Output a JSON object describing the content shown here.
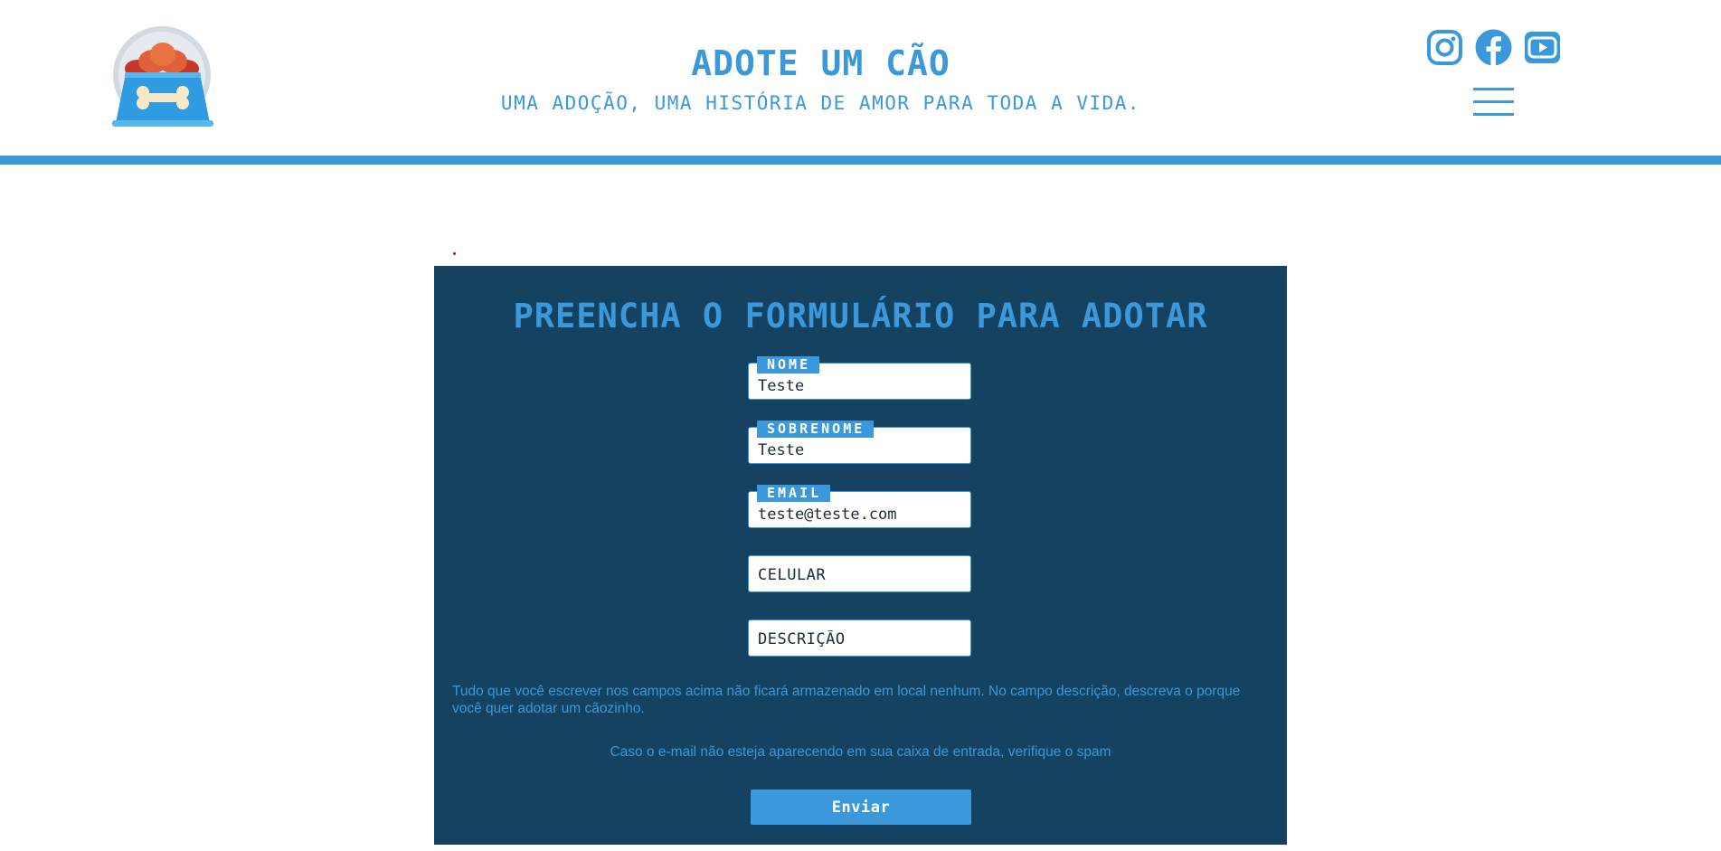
{
  "header": {
    "title": "ADOTE UM CÃO",
    "subtitle": "UMA ADOÇÃO, UMA HISTÓRIA DE AMOR PARA TODA A VIDA.",
    "logo_icon": "dog-food-bowl-icon",
    "social": [
      {
        "name": "instagram-icon"
      },
      {
        "name": "facebook-icon"
      },
      {
        "name": "youtube-icon"
      }
    ],
    "menu_icon": "hamburger-menu-icon"
  },
  "form": {
    "title": "PREENCHA O FORMULÁRIO PARA ADOTAR",
    "fields": {
      "nome": {
        "label": "NOME",
        "value": "Teste"
      },
      "sobrenome": {
        "label": "SOBRENOME",
        "value": "Teste"
      },
      "email": {
        "label": "EMAIL",
        "value": "teste@teste.com"
      },
      "celular": {
        "placeholder": "CELULAR",
        "value": ""
      },
      "descricao": {
        "placeholder": "DESCRIÇÃO",
        "value": ""
      }
    },
    "note": "Tudo que você escrever nos campos acima não ficará armazenado em local nenhum. No campo descrição, descreva o porque você quer adotar um cãozinho.",
    "spam_note": "Caso o e-mail não esteja aparecendo em sua caixa de entrada, verifique o spam",
    "submit_label": "Enviar"
  },
  "colors": {
    "accent": "#3a98db",
    "panel": "#164261",
    "background": "#ffffff"
  }
}
